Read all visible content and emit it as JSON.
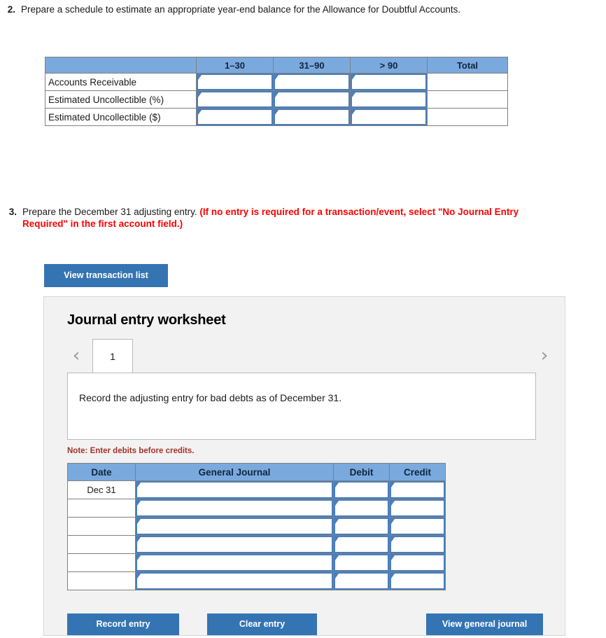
{
  "question2": {
    "number": "2.",
    "text": "Prepare a schedule to estimate an appropriate year-end balance for the Allowance for Doubtful Accounts."
  },
  "question3": {
    "number": "3.",
    "text": "Prepare the December 31 adjusting entry.",
    "red_text": "(If no entry is required for a transaction/event, select \"No Journal Entry Required\" in the first account field.)"
  },
  "aging_table": {
    "headers": [
      "",
      "1–30",
      "31–90",
      "> 90",
      "Total"
    ],
    "rows": [
      {
        "label": "Accounts Receivable",
        "cells": [
          "",
          "",
          ""
        ],
        "total": ""
      },
      {
        "label": "Estimated Uncollectible (%)",
        "cells": [
          "",
          "",
          ""
        ],
        "total": ""
      },
      {
        "label": "Estimated Uncollectible ($)",
        "cells": [
          "",
          "",
          ""
        ],
        "total": ""
      }
    ]
  },
  "buttons": {
    "view_transaction_list": "View transaction list",
    "record_entry": "Record entry",
    "clear_entry": "Clear entry",
    "view_general_journal": "View general journal"
  },
  "worksheet": {
    "title": "Journal entry worksheet",
    "prev_icon": "‹",
    "next_icon": "›",
    "tab_label": "1",
    "description": "Record the adjusting entry for bad debts as of December 31.",
    "note": "Note: Enter debits before credits."
  },
  "journal_table": {
    "headers": [
      "Date",
      "General Journal",
      "Debit",
      "Credit"
    ],
    "rows": [
      {
        "date": "Dec 31",
        "account": "",
        "debit": "",
        "credit": ""
      },
      {
        "date": "",
        "account": "",
        "debit": "",
        "credit": ""
      },
      {
        "date": "",
        "account": "",
        "debit": "",
        "credit": ""
      },
      {
        "date": "",
        "account": "",
        "debit": "",
        "credit": ""
      },
      {
        "date": "",
        "account": "",
        "debit": "",
        "credit": ""
      },
      {
        "date": "",
        "account": "",
        "debit": "",
        "credit": ""
      }
    ]
  },
  "colors": {
    "header_blue": "#7aa9dd",
    "button_blue": "#3574b2",
    "input_border_blue": "#4a7ebb",
    "red_text": "#ff0000",
    "note_red": "#a0342a",
    "panel_bg": "#f2f2f2"
  }
}
